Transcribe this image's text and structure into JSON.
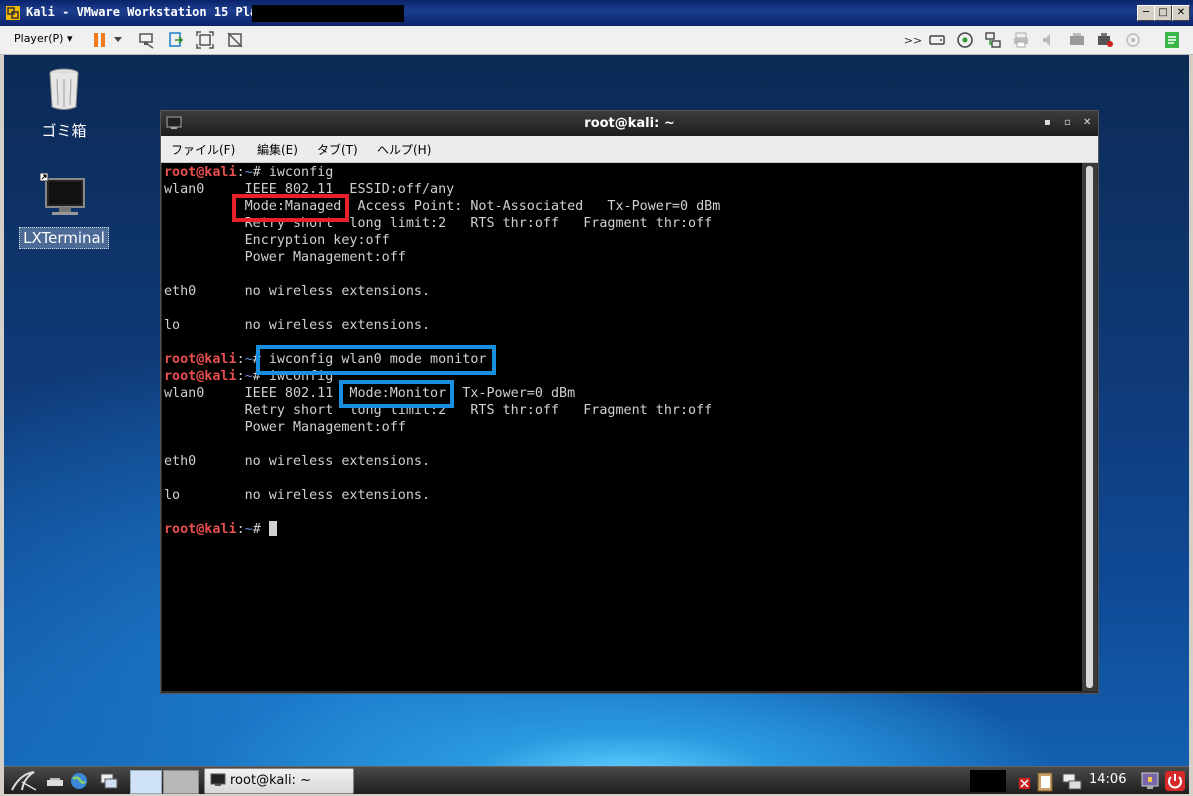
{
  "host_window": {
    "title": "Kali - VMware Workstation 15 Player",
    "player_menu": "Player(P)"
  },
  "desktop": {
    "icons": [
      {
        "label": "ゴミ箱",
        "icon": "trash-bin-icon"
      },
      {
        "label": "LXTerminal",
        "icon": "terminal-monitor-icon"
      }
    ]
  },
  "terminal": {
    "title": "root@kali: ~",
    "menu": [
      "ファイル(F)",
      "編集(E)",
      "タブ(T)",
      "ヘルプ(H)"
    ],
    "prompt_user": "root@kali",
    "prompt_sep": ":",
    "prompt_path": "~",
    "prompt_end": "# ",
    "lines": [
      {
        "type": "prompt",
        "cmd": "iwconfig"
      },
      {
        "type": "out",
        "text": "wlan0     IEEE 802.11  ESSID:off/any  "
      },
      {
        "type": "out",
        "text": "          Mode:Managed  Access Point: Not-Associated   Tx-Power=0 dBm   "
      },
      {
        "type": "out",
        "text": "          Retry short  long limit:2   RTS thr:off   Fragment thr:off"
      },
      {
        "type": "out",
        "text": "          Encryption key:off"
      },
      {
        "type": "out",
        "text": "          Power Management:off"
      },
      {
        "type": "out",
        "text": ""
      },
      {
        "type": "out",
        "text": "eth0      no wireless extensions."
      },
      {
        "type": "out",
        "text": ""
      },
      {
        "type": "out",
        "text": "lo        no wireless extensions."
      },
      {
        "type": "out",
        "text": ""
      },
      {
        "type": "prompt",
        "cmd": "iwconfig wlan0 mode monitor"
      },
      {
        "type": "prompt",
        "cmd": "iwconfig"
      },
      {
        "type": "out",
        "text": "wlan0     IEEE 802.11  Mode:Monitor  Tx-Power=0 dBm   "
      },
      {
        "type": "out",
        "text": "          Retry short  long limit:2   RTS thr:off   Fragment thr:off"
      },
      {
        "type": "out",
        "text": "          Power Management:off"
      },
      {
        "type": "out",
        "text": ""
      },
      {
        "type": "out",
        "text": "eth0      no wireless extensions."
      },
      {
        "type": "out",
        "text": ""
      },
      {
        "type": "out",
        "text": "lo        no wireless extensions."
      },
      {
        "type": "out",
        "text": ""
      },
      {
        "type": "prompt_cursor",
        "cmd": ""
      }
    ]
  },
  "annotations": {
    "managed_color": "#e8202a",
    "monitor_color": "#1a8fe0"
  },
  "taskbar": {
    "task_label": "root@kali: ~",
    "clock": "14:06"
  }
}
